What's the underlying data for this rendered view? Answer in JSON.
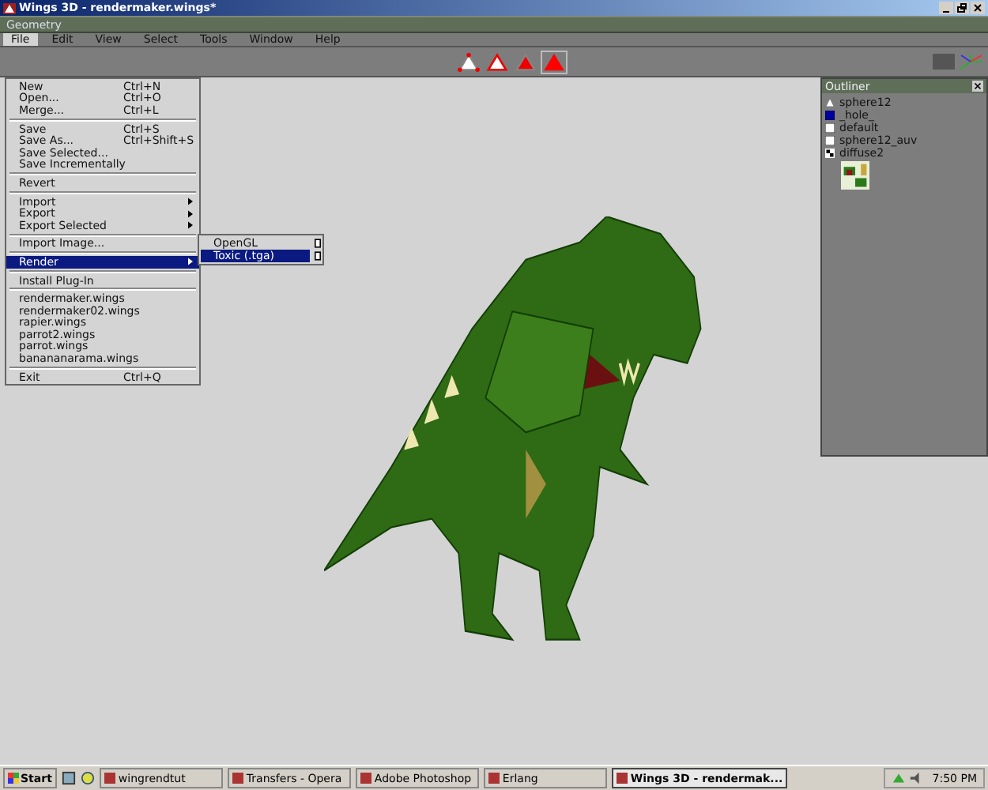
{
  "window": {
    "title": "Wings 3D - rendermaker.wings*"
  },
  "geometry_bar": {
    "label": "Geometry"
  },
  "menubar": [
    {
      "label": "File",
      "selected": true
    },
    {
      "label": "Edit",
      "selected": false
    },
    {
      "label": "View",
      "selected": false
    },
    {
      "label": "Select",
      "selected": false
    },
    {
      "label": "Tools",
      "selected": false
    },
    {
      "label": "Window",
      "selected": false
    },
    {
      "label": "Help",
      "selected": false
    }
  ],
  "toolbar": {
    "modes": [
      {
        "kind": "vertex",
        "selected": false
      },
      {
        "kind": "edge",
        "selected": false
      },
      {
        "kind": "face",
        "selected": false
      },
      {
        "kind": "body",
        "selected": true
      }
    ]
  },
  "file_menu": [
    {
      "kind": "item",
      "label": "New",
      "shortcut": "Ctrl+N",
      "submenu": false,
      "selected": false
    },
    {
      "kind": "item",
      "label": "Open...",
      "shortcut": "Ctrl+O",
      "submenu": false,
      "selected": false
    },
    {
      "kind": "item",
      "label": "Merge...",
      "shortcut": "Ctrl+L",
      "submenu": false,
      "selected": false
    },
    {
      "kind": "separator"
    },
    {
      "kind": "item",
      "label": "Save",
      "shortcut": "Ctrl+S",
      "submenu": false,
      "selected": false
    },
    {
      "kind": "item",
      "label": "Save As...",
      "shortcut": "Ctrl+Shift+S",
      "submenu": false,
      "selected": false
    },
    {
      "kind": "item",
      "label": "Save Selected...",
      "submenu": false,
      "selected": false
    },
    {
      "kind": "item",
      "label": "Save Incrementally",
      "submenu": false,
      "selected": false
    },
    {
      "kind": "separator"
    },
    {
      "kind": "item",
      "label": "Revert",
      "submenu": false,
      "selected": false
    },
    {
      "kind": "separator"
    },
    {
      "kind": "item",
      "label": "Import",
      "submenu": true,
      "selected": false
    },
    {
      "kind": "item",
      "label": "Export",
      "submenu": true,
      "selected": false
    },
    {
      "kind": "item",
      "label": "Export Selected",
      "submenu": true,
      "selected": false
    },
    {
      "kind": "separator"
    },
    {
      "kind": "item",
      "label": "Import Image...",
      "submenu": false,
      "selected": false
    },
    {
      "kind": "separator"
    },
    {
      "kind": "item",
      "label": "Render",
      "submenu": true,
      "selected": true
    },
    {
      "kind": "separator"
    },
    {
      "kind": "item",
      "label": "Install Plug-In",
      "submenu": false,
      "selected": false
    },
    {
      "kind": "separator"
    },
    {
      "kind": "item",
      "label": "rendermaker.wings",
      "submenu": false,
      "selected": false
    },
    {
      "kind": "item",
      "label": "rendermaker02.wings",
      "submenu": false,
      "selected": false
    },
    {
      "kind": "item",
      "label": "rapier.wings",
      "submenu": false,
      "selected": false
    },
    {
      "kind": "item",
      "label": "parrot2.wings",
      "submenu": false,
      "selected": false
    },
    {
      "kind": "item",
      "label": "parrot.wings",
      "submenu": false,
      "selected": false
    },
    {
      "kind": "item",
      "label": "banananarama.wings",
      "submenu": false,
      "selected": false
    },
    {
      "kind": "separator"
    },
    {
      "kind": "item",
      "label": "Exit",
      "shortcut": "Ctrl+Q",
      "submenu": false,
      "selected": false
    }
  ],
  "render_submenu": [
    {
      "label": "OpenGL",
      "selected": false
    },
    {
      "label": "Toxic (.tga)",
      "selected": true
    }
  ],
  "outliner": {
    "title": "Outliner",
    "items": [
      {
        "kind": "object",
        "label": "sphere12"
      },
      {
        "kind": "material",
        "label": "_hole_",
        "color": "#0000a0"
      },
      {
        "kind": "material",
        "label": "default",
        "color": "#ffffff"
      },
      {
        "kind": "material",
        "label": "sphere12_auv",
        "color": "#ffffff"
      },
      {
        "kind": "image",
        "label": "diffuse2"
      }
    ]
  },
  "taskbar": {
    "start": "Start",
    "tasks": [
      {
        "label": "wingrendtut",
        "selected": false
      },
      {
        "label": "Transfers - Opera",
        "selected": false
      },
      {
        "label": "Adobe Photoshop",
        "selected": false
      },
      {
        "label": "Erlang",
        "selected": false
      },
      {
        "label": "Wings 3D - rendermak...",
        "selected": true
      }
    ],
    "clock": "7:50 PM"
  }
}
